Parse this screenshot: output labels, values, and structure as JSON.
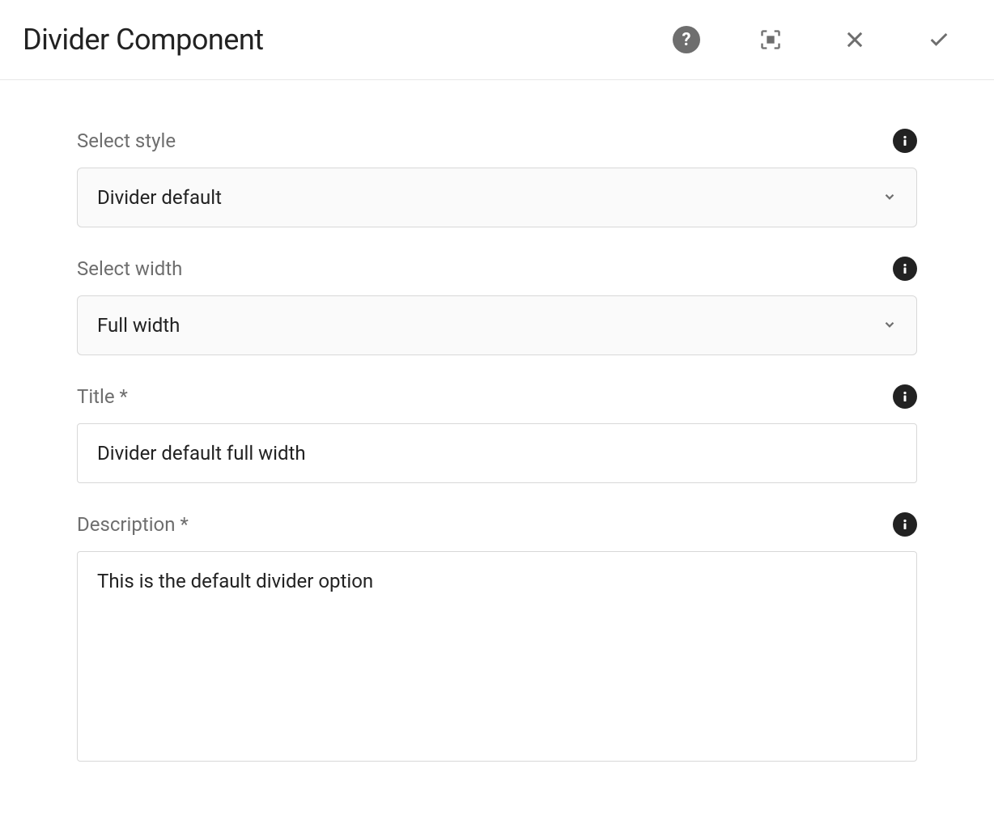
{
  "dialog": {
    "title": "Divider Component"
  },
  "fields": {
    "style": {
      "label": "Select style",
      "value": "Divider default"
    },
    "width": {
      "label": "Select width",
      "value": "Full width"
    },
    "title": {
      "label": "Title *",
      "value": "Divider default full width"
    },
    "description": {
      "label": "Description *",
      "value": "This is the default divider option"
    }
  }
}
